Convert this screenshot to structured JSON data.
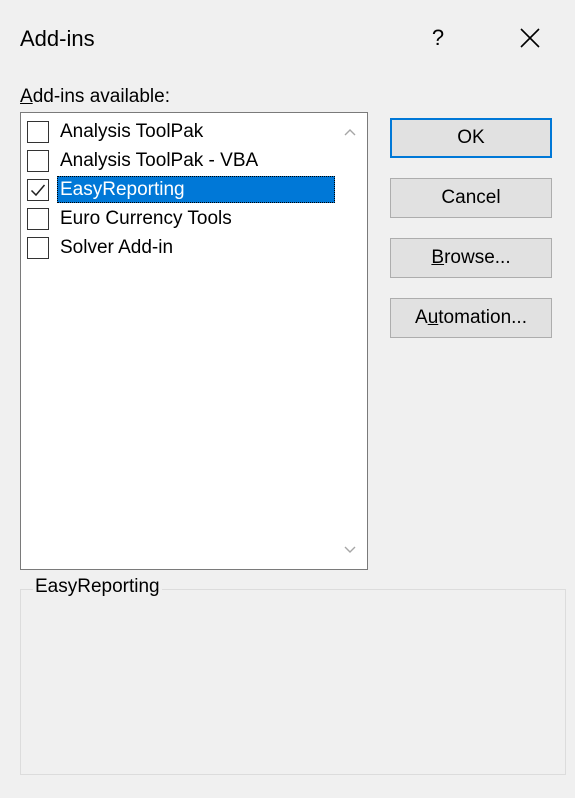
{
  "dialog": {
    "title": "Add-ins",
    "help_label": "?"
  },
  "list": {
    "label_accel": "A",
    "label_rest": "dd-ins available:",
    "items": [
      {
        "label": "Analysis ToolPak",
        "checked": false,
        "selected": false
      },
      {
        "label": "Analysis ToolPak - VBA",
        "checked": false,
        "selected": false
      },
      {
        "label": "EasyReporting",
        "checked": true,
        "selected": true
      },
      {
        "label": "Euro Currency Tools",
        "checked": false,
        "selected": false
      },
      {
        "label": "Solver Add-in",
        "checked": false,
        "selected": false
      }
    ]
  },
  "buttons": {
    "ok": "OK",
    "cancel": "Cancel",
    "browse_accel": "B",
    "browse_rest": "rowse...",
    "automation_pre": "A",
    "automation_accel": "u",
    "automation_rest": "tomation..."
  },
  "description": {
    "title": "EasyReporting"
  },
  "colors": {
    "selection": "#0078d7",
    "default_button_border": "#0078d7",
    "background": "#f0f0f0"
  }
}
